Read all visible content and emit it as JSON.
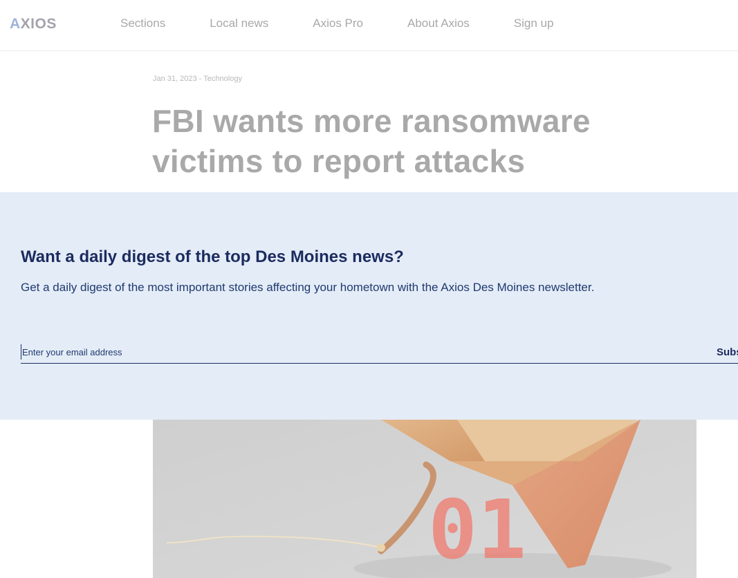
{
  "header": {
    "logo": "AXIOS",
    "nav": [
      "Sections",
      "Local news",
      "Axios Pro",
      "About Axios",
      "Sign up"
    ]
  },
  "article": {
    "date": "Jan 31, 2023",
    "separator": "-",
    "category": "Technology",
    "headline": "FBI wants more ransomware victims to report attacks"
  },
  "newsletter": {
    "title": "Want a daily digest of the top Des Moines news?",
    "description": "Get a daily digest of the most important stories affecting your hometown with the Axios Des Moines newsletter.",
    "email_placeholder": "Enter your email address",
    "email_value": "",
    "subscribe_label": "Subscribe"
  },
  "hero": {
    "overlay_text": "01",
    "icon": "box-trap-illustration"
  },
  "colors": {
    "banner_bg": "#e4ecf7",
    "banner_text": "#1c2b5f",
    "muted_text": "#a9a9a9"
  }
}
